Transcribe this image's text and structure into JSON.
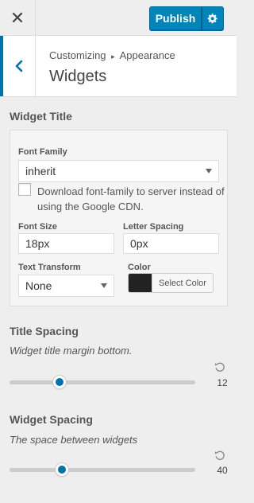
{
  "header": {
    "close_icon": "close-icon",
    "publish_label": "Publish",
    "settings_icon": "gear-icon",
    "accent_color": "#0085ba"
  },
  "section": {
    "back_icon": "chevron-left-icon",
    "breadcrumb_root": "Customizing",
    "breadcrumb_sep": "▸",
    "breadcrumb_leaf": "Appearance",
    "title": "Widgets"
  },
  "widget_title": {
    "heading": "Widget Title",
    "font_family_label": "Font Family",
    "font_family_value": "inherit",
    "download_checkbox_label": "Download font-family to server instead of using the Google CDN.",
    "download_checked": false,
    "font_size_label": "Font Size",
    "font_size_value": "18px",
    "letter_spacing_label": "Letter Spacing",
    "letter_spacing_value": "0px",
    "text_transform_label": "Text Transform",
    "text_transform_value": "None",
    "color_label": "Color",
    "color_button_label": "Select Color",
    "color_value": "#222222"
  },
  "title_spacing": {
    "heading": "Title Spacing",
    "description": "Widget title margin bottom.",
    "value": "12",
    "slider_fraction": 0.27
  },
  "widget_spacing": {
    "heading": "Widget Spacing",
    "description": "The space between widgets",
    "value": "40",
    "slider_fraction": 0.28
  }
}
